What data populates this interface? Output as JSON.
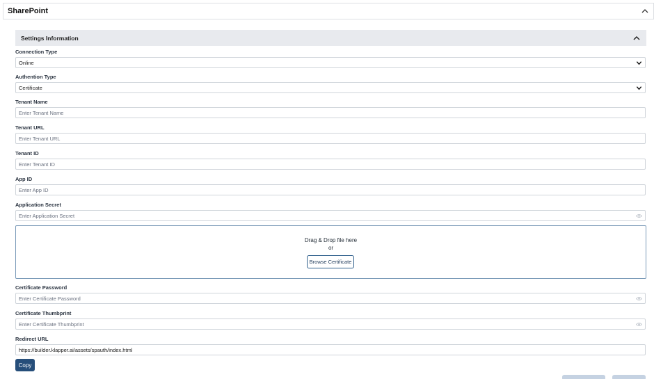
{
  "panel": {
    "title": "SharePoint",
    "collapse_icon": "chevron-up-icon"
  },
  "section": {
    "title": "Settings Information",
    "collapse_icon": "chevron-up-icon"
  },
  "fields": {
    "connection_type": {
      "label": "Connection Type",
      "value": "Online",
      "icon": "chevron-down-icon"
    },
    "authentication_type": {
      "label": "Authention Type",
      "value": "Certificate",
      "icon": "chevron-down-icon"
    },
    "tenant_name": {
      "label": "Tenant Name",
      "placeholder": "Enter Tenant Name"
    },
    "tenant_url": {
      "label": "Tenant URL",
      "placeholder": "Enter Tenant URL"
    },
    "tenant_id": {
      "label": "Tenant ID",
      "placeholder": "Enter Tenant ID"
    },
    "app_id": {
      "label": "App ID",
      "placeholder": "Enter App ID"
    },
    "application_secret": {
      "label": "Application Secret",
      "placeholder": "Enter Application Secret",
      "icon": "eye-icon"
    },
    "certificate_password": {
      "label": "Certificate Password",
      "placeholder": "Enter Certificate Password",
      "icon": "eye-icon"
    },
    "certificate_thumbprint": {
      "label": "Certificate Thumbprint",
      "placeholder": "Enter Certificate Thumbprint",
      "icon": "eye-icon"
    },
    "redirect_url": {
      "label": "Redirect URL",
      "value": "https://builder.klapper.ai/assets/spauth/index.html"
    }
  },
  "dropzone": {
    "line1": "Drag & Drop file here",
    "line2": "or",
    "browse_label": "Browse Certificate"
  },
  "copy_label": "Copy",
  "colors": {
    "primary": "#264e7a",
    "section_bg": "#e8eaee",
    "border": "#cfd4da",
    "dropzone_border": "#7a9ab8",
    "disabled_button": "#c5d2e2"
  }
}
